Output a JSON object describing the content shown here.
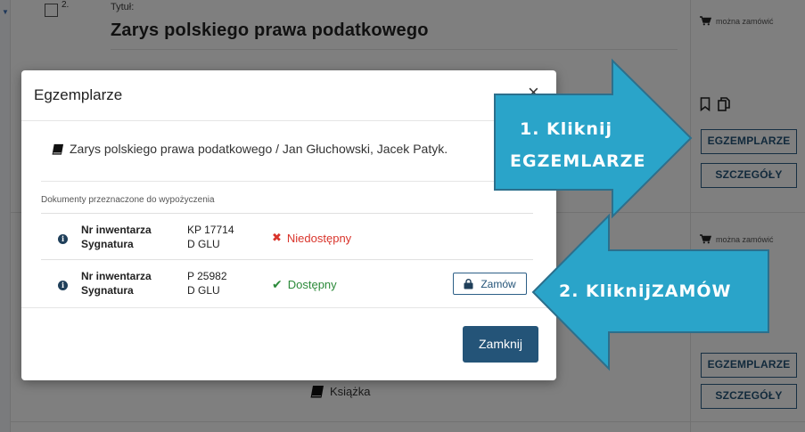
{
  "record": {
    "number": "2.",
    "title_label": "Tytuł:",
    "title": "Zarys polskiego prawa podatkowego"
  },
  "side_panel": {
    "order_info_1": "można zamówić",
    "order_info_2": "można zamówić",
    "copies_button_1": "EGZEMPLARZE",
    "details_button_1": "SZCZEGÓŁY",
    "copies_button_2": "EGZEMPLARZE",
    "details_button_2": "SZCZEGÓŁY"
  },
  "book_type": "Książka",
  "modal": {
    "title": "Egzemplarze",
    "close_symbol": "×",
    "document": "Zarys polskiego prawa podatkowego / Jan Głuchowski, Jacek Patyk.",
    "section_label": "Dokumenty przeznaczone do wypożyczenia",
    "copies": [
      {
        "label_inventory": "Nr inwentarza",
        "label_signature": "Sygnatura",
        "inventory": "KP 17714",
        "signature": "D GLU",
        "status": "Niedostępny",
        "available": false
      },
      {
        "label_inventory": "Nr inwentarza",
        "label_signature": "Sygnatura",
        "inventory": "P 25982",
        "signature": "D GLU",
        "status": "Dostępny",
        "available": true,
        "order_label": "Zamów"
      }
    ],
    "close_label": "Zamknij"
  },
  "callouts": {
    "step1_line1": "1. Kliknij",
    "step1_line2": "EGZEMLARZE",
    "step2": "2. KliknijZAMÓW"
  },
  "colors": {
    "accent": "#245478",
    "callout_fill": "#2aa4c9",
    "callout_border": "#2c6f8c",
    "unavailable": "#d9342b",
    "available": "#2c8a3a"
  }
}
